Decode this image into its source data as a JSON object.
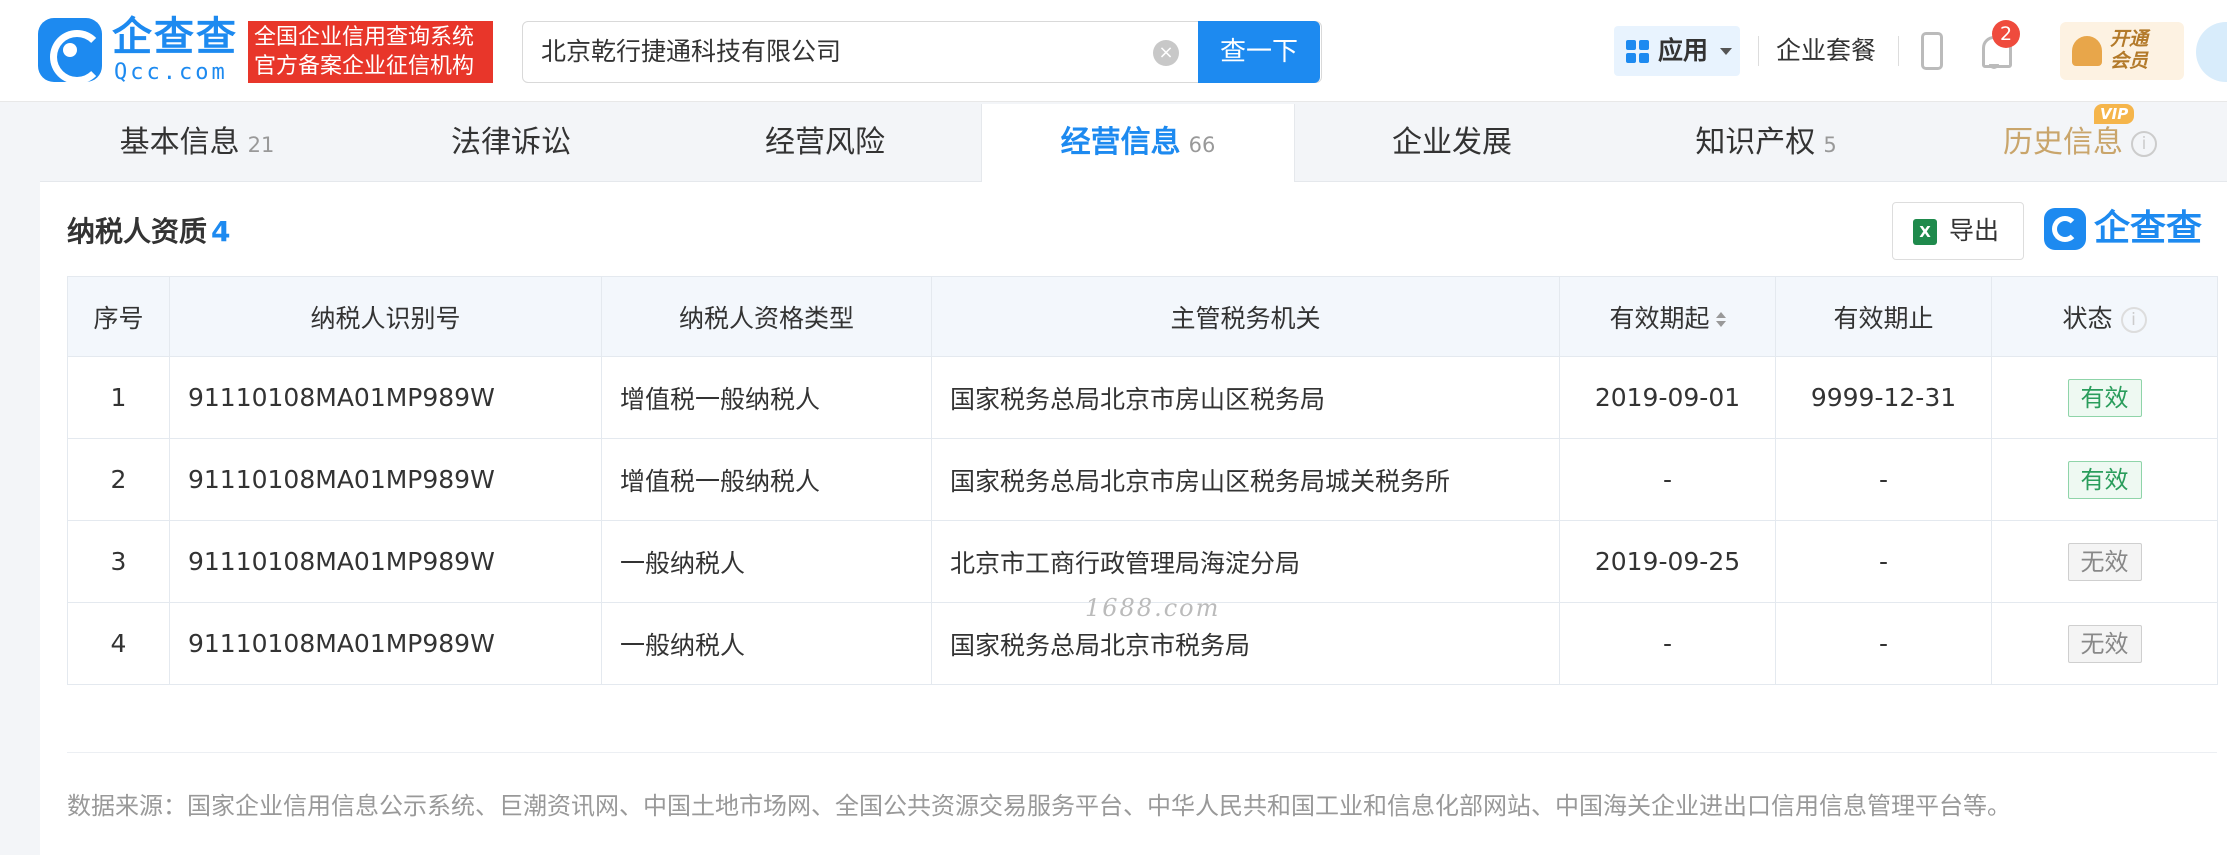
{
  "header": {
    "logo_title": "企查查",
    "logo_sub": "Qcc.com",
    "badge_line1": "全国企业信用查询系统",
    "badge_line2": "官方备案企业征信机构",
    "search_value": "北京乾行捷通科技有限公司",
    "search_button": "查一下",
    "app_label": "应用",
    "package_label": "企业套餐",
    "notif_count": "2",
    "vip_line1": "开通",
    "vip_line2": "会员"
  },
  "tabs": [
    {
      "label": "基本信息",
      "count": "21"
    },
    {
      "label": "法律诉讼",
      "count": ""
    },
    {
      "label": "经营风险",
      "count": ""
    },
    {
      "label": "经营信息",
      "count": "66"
    },
    {
      "label": "企业发展",
      "count": ""
    },
    {
      "label": "知识产权",
      "count": "5"
    },
    {
      "label": "历史信息",
      "count": ""
    }
  ],
  "vip_tag": "VIP",
  "section": {
    "title": "纳税人资质",
    "count": "4",
    "export_label": "导出",
    "brand": "企查查"
  },
  "table": {
    "headers": [
      "序号",
      "纳税人识别号",
      "纳税人资格类型",
      "主管税务机关",
      "有效期起",
      "有效期止",
      "状态"
    ],
    "rows": [
      {
        "no": "1",
        "tax_id": "91110108MA01MP989W",
        "type": "增值税一般纳税人",
        "authority": "国家税务总局北京市房山区税务局",
        "start": "2019-09-01",
        "end": "9999-12-31",
        "status": "有效"
      },
      {
        "no": "2",
        "tax_id": "91110108MA01MP989W",
        "type": "增值税一般纳税人",
        "authority": "国家税务总局北京市房山区税务局城关税务所",
        "start": "-",
        "end": "-",
        "status": "有效"
      },
      {
        "no": "3",
        "tax_id": "91110108MA01MP989W",
        "type": "一般纳税人",
        "authority": "北京市工商行政管理局海淀分局",
        "start": "2019-09-25",
        "end": "-",
        "status": "无效"
      },
      {
        "no": "4",
        "tax_id": "91110108MA01MP989W",
        "type": "一般纳税人",
        "authority": "国家税务总局北京市税务局",
        "start": "-",
        "end": "-",
        "status": "无效"
      }
    ]
  },
  "source_text": "数据来源：国家企业信用信息公示系统、巨潮资讯网、中国土地市场网、全国公共资源交易服务平台、中华人民共和国工业和信息化部网站、中国海关企业进出口信用信息管理平台等。",
  "watermark": "1688.com",
  "colors": {
    "brand": "#1d8af0",
    "badge_red": "#e8362a",
    "valid": "#2a9d5c",
    "vip": "#c9a56b"
  }
}
